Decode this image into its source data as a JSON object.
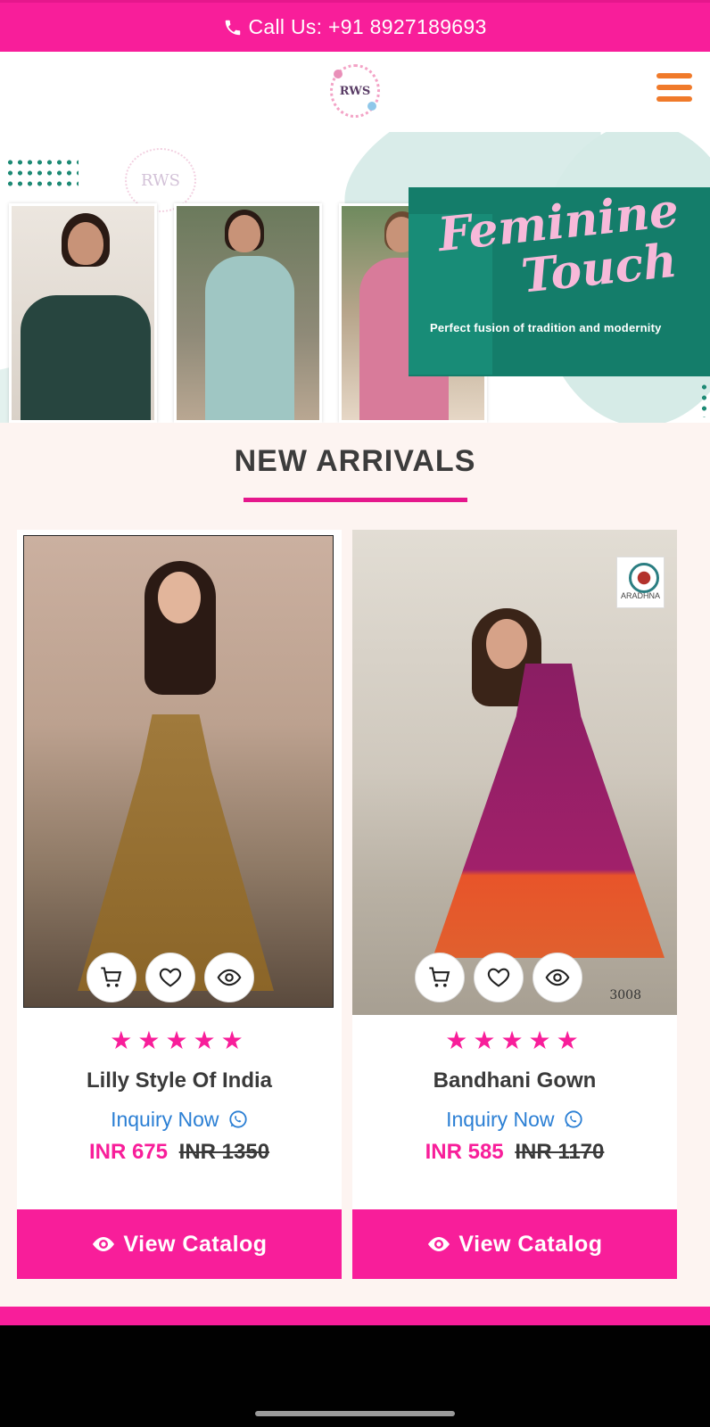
{
  "topbar": {
    "call_text": "Call Us: +91 8927189693"
  },
  "header": {
    "logo_text": "RWS"
  },
  "banner": {
    "watermark": "RWS",
    "headline_line1": "Feminine",
    "headline_line2": "Touch",
    "tagline": "Perfect fusion of tradition and modernity"
  },
  "section": {
    "title": "NEW ARRIVALS"
  },
  "products": [
    {
      "rating": 5,
      "stars": "★★★★★",
      "name": "Lilly Style Of India",
      "inquiry": "Inquiry Now",
      "price_now": "INR 675",
      "price_was": "INR 1350",
      "button": "View Catalog"
    },
    {
      "rating": 5,
      "stars": "★★★★★",
      "name": "Bandhani Gown",
      "inquiry": "Inquiry Now",
      "price_now": "INR 585",
      "price_was": "INR 1170",
      "brand": "ARADHNA",
      "code": "3008",
      "button": "View Catalog"
    }
  ],
  "colors": {
    "accent": "#f81e9a",
    "menu": "#f07a2a",
    "promo": "#147d6a",
    "link": "#2b7fd4"
  },
  "icons": [
    "phone-icon",
    "hamburger-menu-icon",
    "cart-icon",
    "heart-icon",
    "eye-icon",
    "whatsapp-icon"
  ]
}
